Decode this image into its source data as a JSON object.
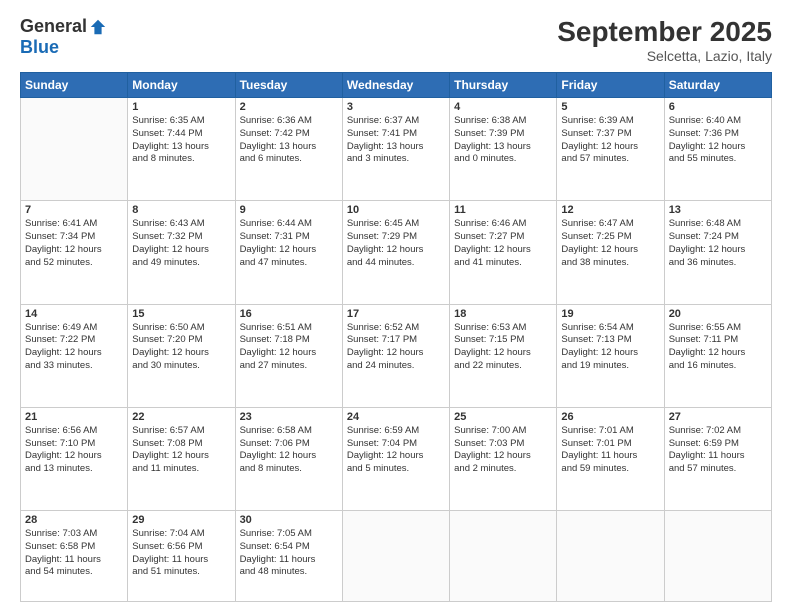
{
  "header": {
    "logo_general": "General",
    "logo_blue": "Blue",
    "month_title": "September 2025",
    "location": "Selcetta, Lazio, Italy"
  },
  "days_of_week": [
    "Sunday",
    "Monday",
    "Tuesday",
    "Wednesday",
    "Thursday",
    "Friday",
    "Saturday"
  ],
  "weeks": [
    [
      {
        "day": "",
        "info": ""
      },
      {
        "day": "1",
        "info": "Sunrise: 6:35 AM\nSunset: 7:44 PM\nDaylight: 13 hours\nand 8 minutes."
      },
      {
        "day": "2",
        "info": "Sunrise: 6:36 AM\nSunset: 7:42 PM\nDaylight: 13 hours\nand 6 minutes."
      },
      {
        "day": "3",
        "info": "Sunrise: 6:37 AM\nSunset: 7:41 PM\nDaylight: 13 hours\nand 3 minutes."
      },
      {
        "day": "4",
        "info": "Sunrise: 6:38 AM\nSunset: 7:39 PM\nDaylight: 13 hours\nand 0 minutes."
      },
      {
        "day": "5",
        "info": "Sunrise: 6:39 AM\nSunset: 7:37 PM\nDaylight: 12 hours\nand 57 minutes."
      },
      {
        "day": "6",
        "info": "Sunrise: 6:40 AM\nSunset: 7:36 PM\nDaylight: 12 hours\nand 55 minutes."
      }
    ],
    [
      {
        "day": "7",
        "info": "Sunrise: 6:41 AM\nSunset: 7:34 PM\nDaylight: 12 hours\nand 52 minutes."
      },
      {
        "day": "8",
        "info": "Sunrise: 6:43 AM\nSunset: 7:32 PM\nDaylight: 12 hours\nand 49 minutes."
      },
      {
        "day": "9",
        "info": "Sunrise: 6:44 AM\nSunset: 7:31 PM\nDaylight: 12 hours\nand 47 minutes."
      },
      {
        "day": "10",
        "info": "Sunrise: 6:45 AM\nSunset: 7:29 PM\nDaylight: 12 hours\nand 44 minutes."
      },
      {
        "day": "11",
        "info": "Sunrise: 6:46 AM\nSunset: 7:27 PM\nDaylight: 12 hours\nand 41 minutes."
      },
      {
        "day": "12",
        "info": "Sunrise: 6:47 AM\nSunset: 7:25 PM\nDaylight: 12 hours\nand 38 minutes."
      },
      {
        "day": "13",
        "info": "Sunrise: 6:48 AM\nSunset: 7:24 PM\nDaylight: 12 hours\nand 36 minutes."
      }
    ],
    [
      {
        "day": "14",
        "info": "Sunrise: 6:49 AM\nSunset: 7:22 PM\nDaylight: 12 hours\nand 33 minutes."
      },
      {
        "day": "15",
        "info": "Sunrise: 6:50 AM\nSunset: 7:20 PM\nDaylight: 12 hours\nand 30 minutes."
      },
      {
        "day": "16",
        "info": "Sunrise: 6:51 AM\nSunset: 7:18 PM\nDaylight: 12 hours\nand 27 minutes."
      },
      {
        "day": "17",
        "info": "Sunrise: 6:52 AM\nSunset: 7:17 PM\nDaylight: 12 hours\nand 24 minutes."
      },
      {
        "day": "18",
        "info": "Sunrise: 6:53 AM\nSunset: 7:15 PM\nDaylight: 12 hours\nand 22 minutes."
      },
      {
        "day": "19",
        "info": "Sunrise: 6:54 AM\nSunset: 7:13 PM\nDaylight: 12 hours\nand 19 minutes."
      },
      {
        "day": "20",
        "info": "Sunrise: 6:55 AM\nSunset: 7:11 PM\nDaylight: 12 hours\nand 16 minutes."
      }
    ],
    [
      {
        "day": "21",
        "info": "Sunrise: 6:56 AM\nSunset: 7:10 PM\nDaylight: 12 hours\nand 13 minutes."
      },
      {
        "day": "22",
        "info": "Sunrise: 6:57 AM\nSunset: 7:08 PM\nDaylight: 12 hours\nand 11 minutes."
      },
      {
        "day": "23",
        "info": "Sunrise: 6:58 AM\nSunset: 7:06 PM\nDaylight: 12 hours\nand 8 minutes."
      },
      {
        "day": "24",
        "info": "Sunrise: 6:59 AM\nSunset: 7:04 PM\nDaylight: 12 hours\nand 5 minutes."
      },
      {
        "day": "25",
        "info": "Sunrise: 7:00 AM\nSunset: 7:03 PM\nDaylight: 12 hours\nand 2 minutes."
      },
      {
        "day": "26",
        "info": "Sunrise: 7:01 AM\nSunset: 7:01 PM\nDaylight: 11 hours\nand 59 minutes."
      },
      {
        "day": "27",
        "info": "Sunrise: 7:02 AM\nSunset: 6:59 PM\nDaylight: 11 hours\nand 57 minutes."
      }
    ],
    [
      {
        "day": "28",
        "info": "Sunrise: 7:03 AM\nSunset: 6:58 PM\nDaylight: 11 hours\nand 54 minutes."
      },
      {
        "day": "29",
        "info": "Sunrise: 7:04 AM\nSunset: 6:56 PM\nDaylight: 11 hours\nand 51 minutes."
      },
      {
        "day": "30",
        "info": "Sunrise: 7:05 AM\nSunset: 6:54 PM\nDaylight: 11 hours\nand 48 minutes."
      },
      {
        "day": "",
        "info": ""
      },
      {
        "day": "",
        "info": ""
      },
      {
        "day": "",
        "info": ""
      },
      {
        "day": "",
        "info": ""
      }
    ]
  ]
}
